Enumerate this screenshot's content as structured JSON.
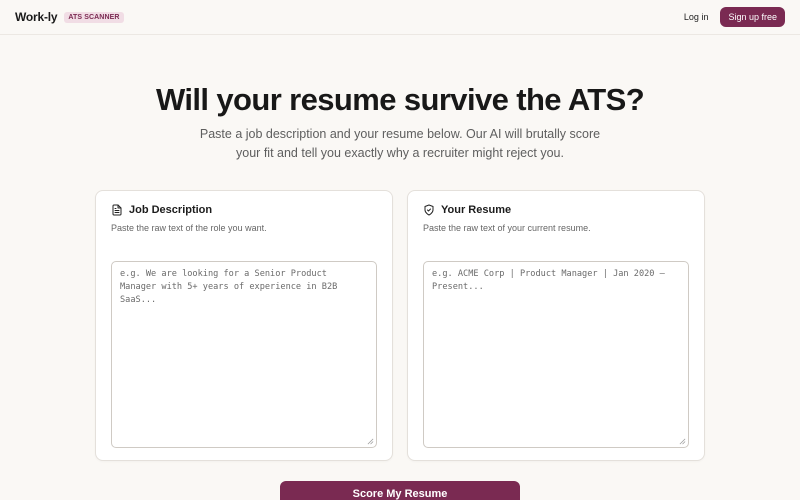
{
  "header": {
    "brand": "Work-ly",
    "badge": "ATS SCANNER",
    "login_label": "Log in",
    "signup_label": "Sign up free"
  },
  "hero": {
    "title": "Will your resume survive the ATS?",
    "subtitle": "Paste a job description and your resume below. Our AI will brutally score your fit and tell you exactly why a recruiter might reject you."
  },
  "job_card": {
    "icon": "document-icon",
    "title": "Job Description",
    "subtitle": "Paste the raw text of the role you want.",
    "placeholder": "e.g. We are looking for a Senior Product Manager with 5+ years of experience in B2B SaaS..."
  },
  "resume_card": {
    "icon": "shield-check-icon",
    "title": "Your Resume",
    "subtitle": "Paste the raw text of your current resume.",
    "placeholder": "e.g. ACME Corp | Product Manager | Jan 2020 – Present..."
  },
  "actions": {
    "score_label": "Score My Resume"
  },
  "colors": {
    "accent": "#7a2a52",
    "badge_bg": "#f1dde5",
    "background": "#faf8f5"
  }
}
